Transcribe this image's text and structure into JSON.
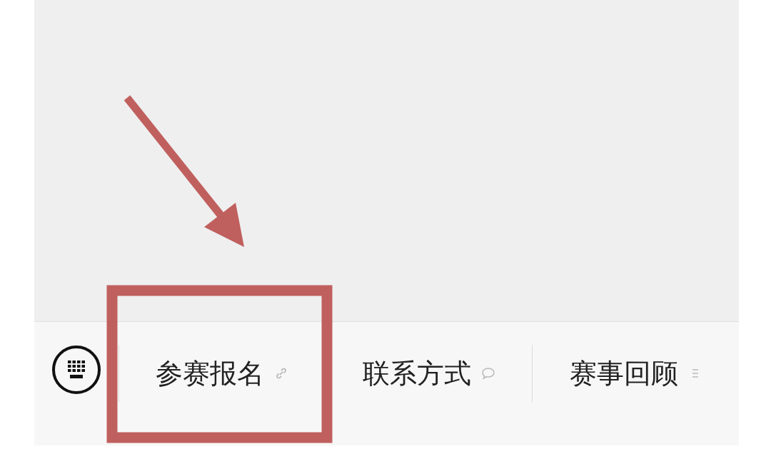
{
  "menu_bar": {
    "items": [
      {
        "label": "参赛报名",
        "kind": "link"
      },
      {
        "label": "联系方式",
        "kind": "message"
      },
      {
        "label": "赛事回顾",
        "kind": "list"
      }
    ]
  }
}
